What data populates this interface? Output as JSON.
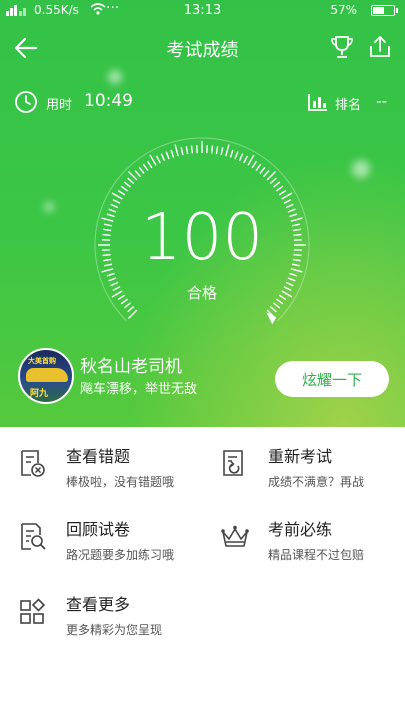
{
  "status": {
    "signal": "ᯤll",
    "speed": "0.55K/s",
    "time": "13:13",
    "battery": "57%",
    "battery_level": 0.57
  },
  "nav": {
    "title": "考试成绩"
  },
  "meta": {
    "time_label": "用时",
    "time_value": "10:49",
    "rank_label": "排名",
    "rank_value": "--"
  },
  "result": {
    "score": "100",
    "grade": "合格",
    "progress": 1.0
  },
  "user": {
    "name": "秋名山老司机",
    "motto": "飚车漂移，举世无敌",
    "avatar_text_top": "大美首购",
    "avatar_text_bottom": "阿九"
  },
  "share_button": {
    "label": "炫耀一下"
  },
  "menu": {
    "items": [
      {
        "title": "查看错题",
        "subtitle": "棒极啦，没有错题哦",
        "icon": "wrong-questions-icon"
      },
      {
        "title": "重新考试",
        "subtitle": "成绩不满意？再战",
        "icon": "retake-exam-icon"
      },
      {
        "title": "回顾试卷",
        "subtitle": "路况题要多加练习哦",
        "icon": "review-paper-icon"
      },
      {
        "title": "考前必练",
        "subtitle": "精品课程不过包赔",
        "icon": "crown-icon"
      },
      {
        "title": "查看更多",
        "subtitle": "更多精彩为您呈现",
        "icon": "grid-more-icon"
      }
    ]
  },
  "colors": {
    "green": "#3cc646",
    "accent_text": "#2fb44a"
  }
}
